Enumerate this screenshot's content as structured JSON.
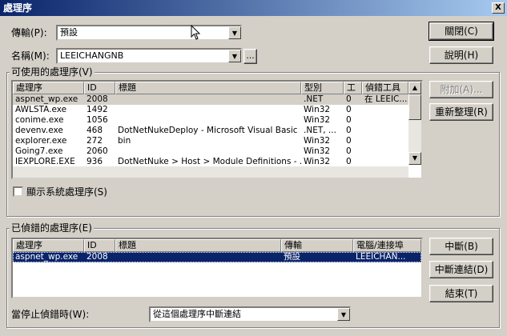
{
  "window": {
    "title": "處理序",
    "close_glyph": "X"
  },
  "transport": {
    "label": "傳輸(P):",
    "value": "預設"
  },
  "name": {
    "label": "名稱(M):",
    "value": "LEEICHANGNB",
    "browse_label": "..."
  },
  "available": {
    "group_title": "可使用的處理序(V)",
    "columns": [
      "處理序",
      "ID",
      "標題",
      "型別",
      "工",
      "偵錯工具"
    ],
    "rows": [
      {
        "process": "aspnet_wp.exe",
        "id": "2008",
        "title": "",
        "type": ".NET",
        "session": "0",
        "debugger": "在 LEEIC..."
      },
      {
        "process": "AWLSTA.exe",
        "id": "1492",
        "title": "",
        "type": "Win32",
        "session": "0",
        "debugger": ""
      },
      {
        "process": "conime.exe",
        "id": "1056",
        "title": "",
        "type": "Win32",
        "session": "0",
        "debugger": ""
      },
      {
        "process": "devenv.exe",
        "id": "468",
        "title": "DotNetNukeDeploy - Microsoft Visual Basic ...",
        "type": ".NET, ...",
        "session": "0",
        "debugger": ""
      },
      {
        "process": "explorer.exe",
        "id": "272",
        "title": "bin",
        "type": "Win32",
        "session": "0",
        "debugger": ""
      },
      {
        "process": "Going7.exe",
        "id": "2060",
        "title": "",
        "type": "Win32",
        "session": "0",
        "debugger": ""
      },
      {
        "process": "IEXPLORE.EXE",
        "id": "936",
        "title": "DotNetNuke > Host > Module Definitions - ...",
        "type": "Win32",
        "session": "0",
        "debugger": ""
      }
    ],
    "show_system_label": "顯示系統處理序(S)",
    "show_system_checked": false
  },
  "debugged": {
    "group_title": "已偵錯的處理序(E)",
    "columns": [
      "處理序",
      "ID",
      "標題",
      "傳輸",
      "電腦/連接埠"
    ],
    "rows": [
      {
        "process": "aspnet_wp.exe",
        "id": "2008",
        "title": "",
        "transport": "預設",
        "machine": "LEEICHAN..."
      }
    ]
  },
  "when_stop": {
    "label": "當停止偵錯時(W):",
    "value": "從這個處理序中斷連結"
  },
  "buttons": {
    "close": "關閉(C)",
    "help": "說明(H)",
    "attach": "附加(A)...",
    "refresh": "重新整理(R)",
    "break": "中斷(B)",
    "detach": "中斷連結(D)",
    "terminate": "結束(T)"
  },
  "glyphs": {
    "arrow_down": "▼",
    "arrow_up": "▲"
  }
}
